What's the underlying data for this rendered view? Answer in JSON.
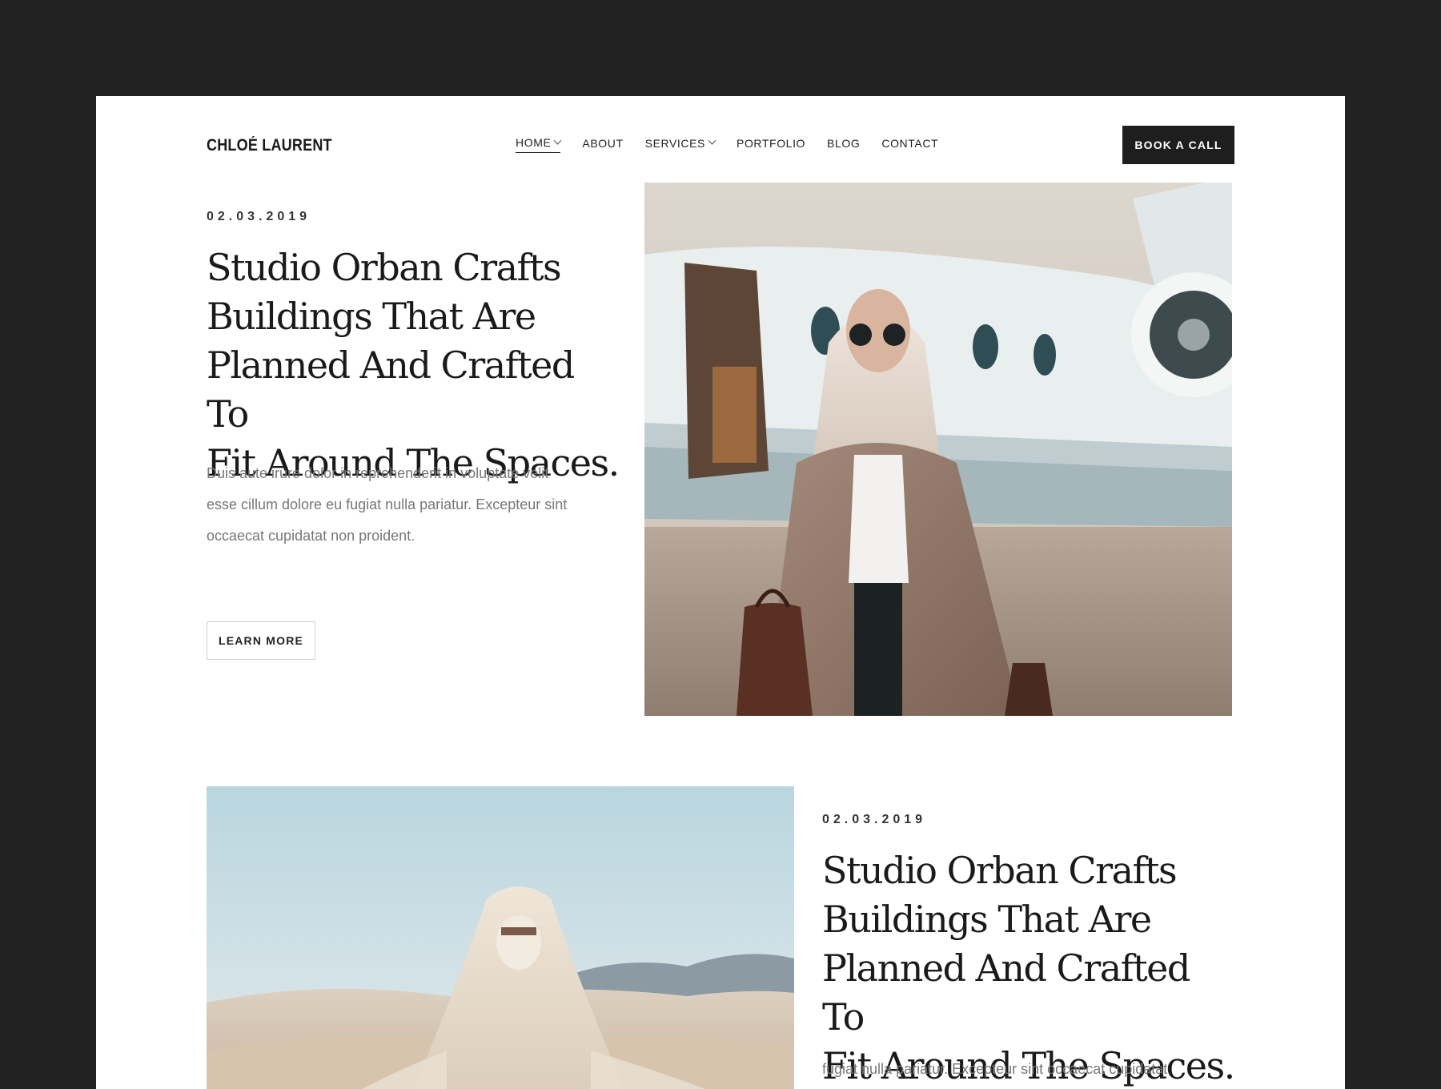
{
  "header": {
    "logo": "CHLOÉ LAURENT",
    "nav": [
      {
        "label": "HOME",
        "has_dropdown": true,
        "active": true
      },
      {
        "label": "ABOUT",
        "has_dropdown": false
      },
      {
        "label": "SERVICES",
        "has_dropdown": true
      },
      {
        "label": "PORTFOLIO",
        "has_dropdown": false
      },
      {
        "label": "BLOG",
        "has_dropdown": false
      },
      {
        "label": "CONTACT",
        "has_dropdown": false
      }
    ],
    "cta_label": "BOOK A CALL"
  },
  "articles": [
    {
      "date": "02.03.2019",
      "title_lines": [
        "Studio Orban Crafts",
        "Buildings That Are",
        "Planned And Crafted To",
        "Fit Around The Spaces."
      ],
      "excerpt_lines": [
        "Duis aute irure dolor in reprehenderit in voluptate velit",
        "esse cillum dolore eu fugiat nulla pariatur. Excepteur sint",
        "occaecat cupidatat non proident."
      ],
      "button_label": "LEARN MORE"
    },
    {
      "date": "02.03.2019",
      "title_lines": [
        "Studio Orban Crafts",
        "Buildings That Are",
        "Planned And Crafted To",
        "Fit Around The Spaces."
      ],
      "excerpt_lines": [
        "fugiat nulla pariatur. Excepteur sint occaecat cupidatat"
      ]
    }
  ],
  "colors": {
    "outer_background": "#222222",
    "page_background": "#ffffff",
    "cta_background": "#1e1e1e",
    "text_dark": "#1a1a1a",
    "text_muted": "#777777"
  }
}
